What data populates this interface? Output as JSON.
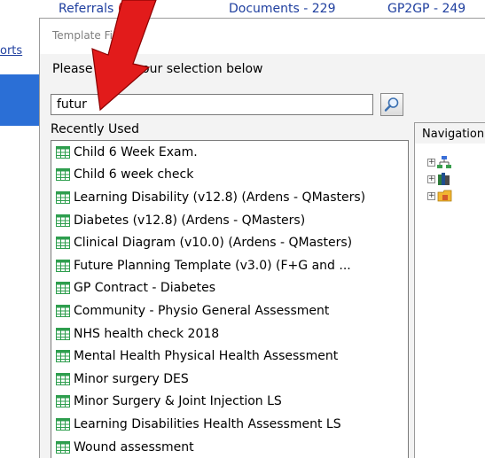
{
  "background": {
    "tabs": [
      {
        "label": "Referrals",
        "count": "(164)",
        "left": 0
      },
      {
        "label": "Documents - 229",
        "count": "",
        "left": 0
      },
      {
        "label": "GP2GP - 249",
        "count": "",
        "left": 0
      }
    ],
    "left_link": "orts"
  },
  "dialog": {
    "title": "Template Finder",
    "prompt": "Please make your selection below",
    "search": {
      "value": "futur",
      "placeholder": ""
    },
    "recent_label": "Recently Used",
    "navigation_label": "Navigation",
    "items": [
      "Child 6 Week Exam.",
      "Child 6 week check",
      "Learning Disability (v12.8) (Ardens - QMasters)",
      "Diabetes (v12.8) (Ardens - QMasters)",
      "Clinical Diagram (v10.0) (Ardens - QMasters)",
      "Future Planning Template (v3.0) (F+G and ...",
      "GP Contract - Diabetes",
      "Community - Physio General Assessment",
      "NHS health check 2018",
      "Mental Health Physical Health Assessment",
      "Minor surgery DES",
      "Minor Surgery & Joint Injection LS",
      "Learning Disabilities Health Assessment LS",
      "Wound assessment"
    ],
    "tree_nodes": [
      "org-chart-icon",
      "books-icon",
      "folder-icon"
    ]
  },
  "colors": {
    "link": "#1f3f9f",
    "count": "#cc2020",
    "grid_icon": "#2e9e4e",
    "arrow": "#e21b1b"
  }
}
